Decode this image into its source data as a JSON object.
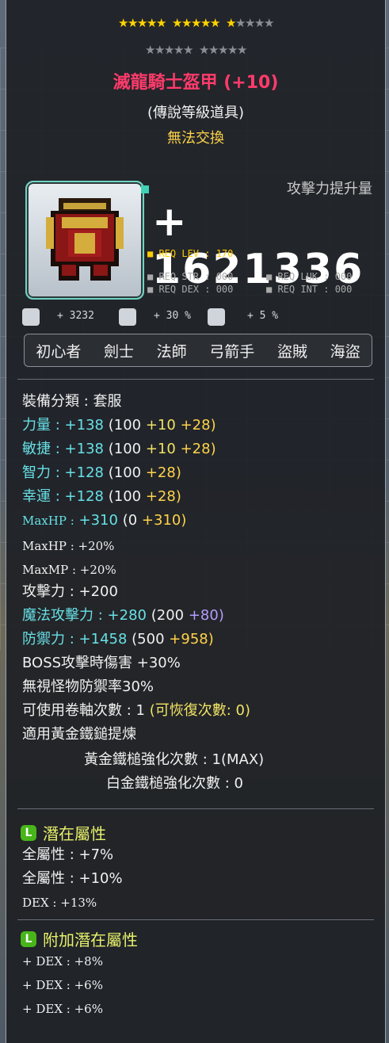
{
  "stars": {
    "row1_filled": 11,
    "row1_total": 15,
    "row2_total": 10
  },
  "item": {
    "name": "滅龍騎士盔甲 (+10)",
    "grade": "(傳說等級道具)",
    "trade": "無法交換"
  },
  "attack": {
    "label": "攻擊力提升量",
    "value": "+ 1621336"
  },
  "req": {
    "lev": "■ REQ LEV : 170",
    "str": "■ REQ STR : 000",
    "luk": "■ REQ LUK : 000",
    "dex": "■ REQ DEX : 000",
    "int": "■ REQ INT : 000"
  },
  "small_stats": {
    "a": "+ 3232",
    "b": "+ 30 %",
    "c": "+ 5 %"
  },
  "jobs": [
    "初心者",
    "劍士",
    "法師",
    "弓箭手",
    "盜賊",
    "海盜"
  ],
  "stats": {
    "category": "裝備分類 : 套服",
    "str": {
      "label": "力量 :",
      "total": "+138",
      "base": "(100",
      "a": "+10",
      "b": "+28)"
    },
    "dex": {
      "label": "敏捷 :",
      "total": "+138",
      "base": "(100",
      "a": "+10",
      "b": "+28)"
    },
    "int": {
      "label": "智力 :",
      "total": "+128",
      "base": "(100",
      "b": "+28)"
    },
    "luk": {
      "label": "幸運 :",
      "total": "+128",
      "base": "(100",
      "b": "+28)"
    },
    "maxhp_flat": {
      "label": "MaxHP :",
      "total": "+310",
      "base": "(0",
      "a": "+310)"
    },
    "maxhp_pct": "MaxHP : +20%",
    "maxmp_pct": "MaxMP : +20%",
    "atk": "攻擊力 : +200",
    "matk": {
      "label": "魔法攻擊力 :",
      "total": "+280",
      "base": "(200",
      "a": "+80)"
    },
    "def": {
      "label": "防禦力 :",
      "total": "+1458",
      "base": "(500",
      "a": "+958)"
    },
    "boss": "BOSS攻擊時傷害 +30%",
    "ignore": "無視怪物防禦率30%",
    "scroll": "可使用卷軸次數 : 1",
    "scroll_recover": "(可恢復次數: 0)",
    "hammer": "適用黃金鐵鎚提煉",
    "gold_hammer": "黃金鐵槌強化次數 : 1(MAX)",
    "plat_hammer": "白金鐵槌強化次數 : 0"
  },
  "potential": {
    "badge": "L",
    "title": "潛在屬性",
    "lines": [
      "全屬性 : +7%",
      "全屬性 : +10%",
      "DEX : +13%"
    ]
  },
  "additional": {
    "badge": "L",
    "title": "附加潛在屬性",
    "lines": [
      "+ DEX : +8%",
      "+ DEX : +6%",
      "+ DEX : +6%"
    ]
  },
  "colors": {
    "name": "#ff3b6b",
    "cyan": "#66e0e6",
    "yellow": "#f0e266",
    "purple": "#b39cff",
    "gold": "#ffd34a"
  }
}
